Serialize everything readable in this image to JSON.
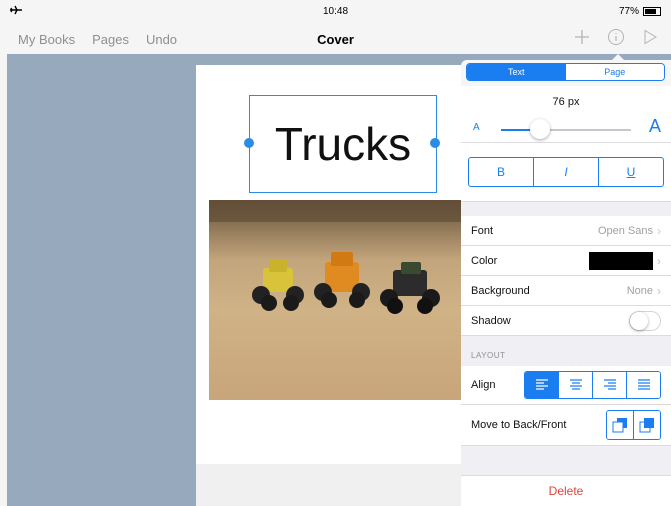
{
  "status_bar": {
    "time": "10:48",
    "battery": "77%",
    "battery_level": 0.77
  },
  "nav": {
    "left_items": [
      "My Books",
      "Pages",
      "Undo"
    ],
    "title": "Cover",
    "right_icons": [
      "plus-icon",
      "info-icon",
      "play-icon"
    ]
  },
  "page": {
    "title_text": "Trucks",
    "image": "toy-trucks-photo"
  },
  "inspector": {
    "tabs": [
      {
        "label": "Text",
        "active": true
      },
      {
        "label": "Page",
        "active": false
      }
    ],
    "font_size": "76 px",
    "slider": {
      "small_label": "A",
      "big_label": "A",
      "level": 0.3
    },
    "styles": [
      "B",
      "I",
      "U"
    ],
    "rows": {
      "font": {
        "label": "Font",
        "value": "Open Sans"
      },
      "color": {
        "label": "Color",
        "swatch": "#000000"
      },
      "background": {
        "label": "Background",
        "value": "None"
      },
      "shadow": {
        "label": "Shadow",
        "on": false
      }
    },
    "layout_header": "LAYOUT",
    "align": {
      "label": "Align",
      "options": [
        "align-left-icon",
        "align-center-icon",
        "align-right-icon",
        "align-justify-icon"
      ],
      "selected": 0
    },
    "move": {
      "label": "Move to Back/Front",
      "options": [
        "send-to-back-icon",
        "bring-to-front-icon"
      ]
    },
    "delete_label": "Delete"
  },
  "colors": {
    "accent": "#1a7ef0",
    "delete": "#e0433b",
    "canvas": "#97a9bd"
  }
}
